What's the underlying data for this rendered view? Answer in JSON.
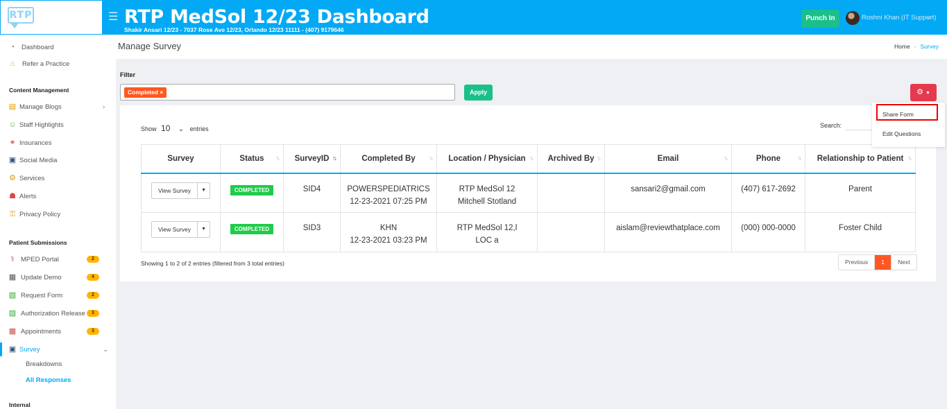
{
  "header": {
    "logo_text": "RTP",
    "title": "RTP MedSol 12/23 Dashboard",
    "subtitle": "Shakir Ansari 12/23 - 7037 Rose Ave 12/23, Orlando 12/23 11111 - (407) 9179646",
    "punch_label": "Punch In",
    "user_name": "Roshni Khan (IT Support)",
    "colors": {
      "primary": "#03a9f4",
      "punch": "#1bbf8a"
    }
  },
  "sidebar": {
    "top_items": [
      {
        "label": "Dashboard",
        "icon": "dashboard-icon"
      },
      {
        "label": "Refer a Practice",
        "icon": "refer-icon"
      }
    ],
    "content_heading": "Content Management",
    "content_items": [
      {
        "label": "Manage Blogs",
        "icon": "blog-icon"
      },
      {
        "label": "Staff Highlights",
        "icon": "staff-icon"
      },
      {
        "label": "Insurances",
        "icon": "insurance-icon"
      },
      {
        "label": "Social Media",
        "icon": "social-icon"
      },
      {
        "label": "Services",
        "icon": "services-icon"
      },
      {
        "label": "Alerts",
        "icon": "alert-icon"
      },
      {
        "label": "Privacy Policy",
        "icon": "privacy-icon"
      }
    ],
    "patient_heading": "Patient Submissions",
    "patient_items": [
      {
        "label": "MPED Portal",
        "badge": "2",
        "icon": "portal-icon"
      },
      {
        "label": "Update Demo",
        "badge": "4",
        "icon": "demo-icon"
      },
      {
        "label": "Request Form",
        "badge": "2",
        "icon": "form-icon"
      },
      {
        "label": "Authorization Release",
        "badge": "3",
        "icon": "auth-icon"
      },
      {
        "label": "Appointments",
        "badge": "3",
        "icon": "calendar-icon"
      },
      {
        "label": "Survey",
        "icon": "survey-icon"
      }
    ],
    "survey_sub": [
      "Breakdowns",
      "All Responses"
    ],
    "internal_heading": "Internal"
  },
  "topbar": {
    "heading": "Manage Survey",
    "crumb_home": "Home",
    "crumb_current": "Survey"
  },
  "filter": {
    "label": "Filter",
    "tag": "Completed ×",
    "apply": "Apply"
  },
  "dropdown": {
    "items": [
      "Share Form",
      "Edit Questions"
    ]
  },
  "table_controls": {
    "show_prefix": "Show",
    "show_value": "10",
    "show_suffix": "entries",
    "search_label": "Search:"
  },
  "table": {
    "columns": [
      "Survey",
      "Status",
      "SurveyID",
      "Completed By",
      "Location / Physician",
      "Archived By",
      "Email",
      "Phone",
      "Relationship to Patient"
    ],
    "rows": [
      {
        "view": "View Survey",
        "status": "COMPLETED",
        "id": "SID4",
        "completed_by": "POWERSPEDIATRICS",
        "completed_at": "12-23-2021 07:25 PM",
        "location": "RTP MedSol 12",
        "physician": "Mitchell Stotland",
        "archived_by": "",
        "email": "sansari2@gmail.com",
        "phone": "(407) 617-2692",
        "relationship": "Parent"
      },
      {
        "view": "View Survey",
        "status": "COMPLETED",
        "id": "SID3",
        "completed_by": "KHN",
        "completed_at": "12-23-2021 03:23 PM",
        "location": "RTP MedSol 12,l",
        "physician": "LOC a",
        "archived_by": "",
        "email": "aislam@reviewthatplace.com",
        "phone": "(000) 000-0000",
        "relationship": "Foster Child"
      }
    ]
  },
  "footer": {
    "info": "Showing 1 to 2 of 2 entries (filtered from 3 total entries)",
    "prev": "Previous",
    "page": "1",
    "next": "Next"
  }
}
